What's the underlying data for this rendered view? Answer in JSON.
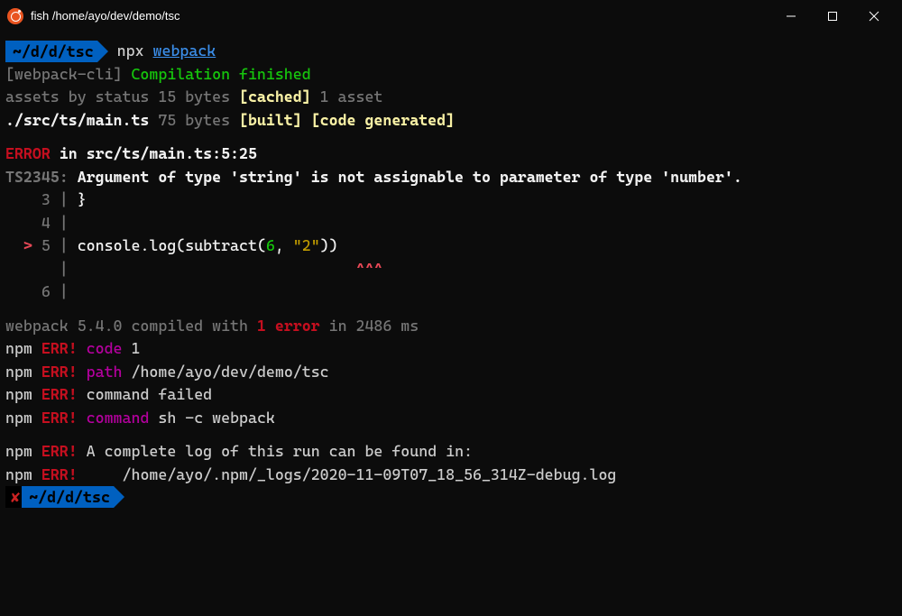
{
  "window": {
    "title": "fish /home/ayo/dev/demo/tsc"
  },
  "prompt1": {
    "cwd": "~/d/d/tsc",
    "cmd_bin": "npx",
    "cmd_arg": "webpack"
  },
  "output": {
    "webpack_cli_prefix": "[webpack-cli]",
    "webpack_cli_msg": "Compilation finished",
    "assets_line_pre": "assets by status 15 bytes ",
    "cached_tag": "[cached]",
    "assets_line_post": " 1 asset",
    "file_line_name": "./src/ts/main.ts",
    "file_line_size": " 75 bytes ",
    "built_tag": "[built]",
    "codegen_tag": "[code generated]",
    "error_word": "ERROR",
    "error_in": " in ",
    "error_loc": "src/ts/main.ts:5:25",
    "ts_code": "TS2345:",
    "ts_msg": " Argument of type 'string' is not assignable to parameter of type 'number'.",
    "code": {
      "l3": {
        "num": "3",
        "text": "}"
      },
      "l4": {
        "num": "4",
        "text": ""
      },
      "l5": {
        "num": "5",
        "marker": ">",
        "pre": "console.log(subtract(",
        "num6": "6",
        "comma": ", ",
        "str": "\"2\"",
        "post": "))",
        "caret": "^^^"
      },
      "l6": {
        "num": "6",
        "text": ""
      }
    },
    "summary_pre": "webpack 5.4.0 compiled with ",
    "summary_err": "1 error",
    "summary_post": " in 2486 ms",
    "npm": {
      "code_key": "code",
      "code_val": "1",
      "path_key": "path",
      "path_val": "/home/ayo/dev/demo/tsc",
      "cmd_failed": "command failed",
      "cmd_key": "command",
      "cmd_val": "sh -c webpack",
      "log_msg": "A complete log of this run can be found in:",
      "log_path": "/home/ayo/.npm/_logs/2020-11-09T07_18_56_314Z-debug.log",
      "pre": "npm",
      "err": "ERR!"
    }
  },
  "prompt2": {
    "status": "✘",
    "cwd": "~/d/d/tsc"
  }
}
